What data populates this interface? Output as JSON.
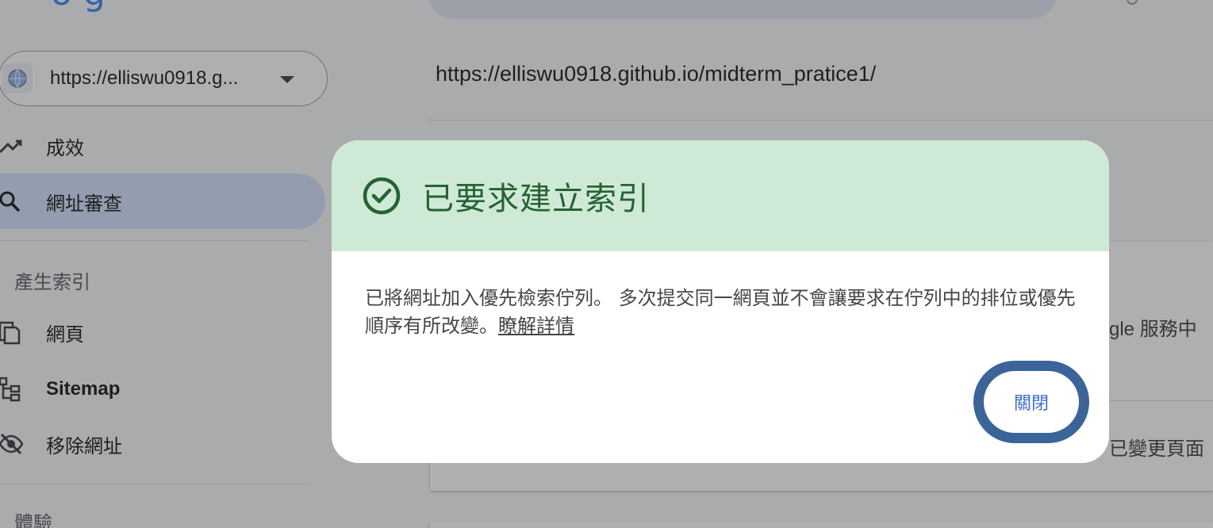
{
  "sidebar": {
    "property": "https://elliswu0918.g...",
    "items": [
      {
        "label": "成效",
        "icon": "trending-up-icon"
      },
      {
        "label": "網址審查",
        "icon": "search-icon",
        "active": true
      },
      {
        "label": "網頁",
        "icon": "pages-icon"
      },
      {
        "label": "Sitemap",
        "icon": "sitemap-icon"
      },
      {
        "label": "移除網址",
        "icon": "visibility-off-icon"
      }
    ],
    "sections": {
      "indexing": "產生索引",
      "experience": "體驗"
    }
  },
  "main": {
    "inspected_url": "https://elliswu0918.github.io/midterm_pratice1/",
    "card_text_1": "gle 服務中",
    "card_text_2": "已變更頁面"
  },
  "dialog": {
    "title": "已要求建立索引",
    "body": "已將網址加入優先檢索佇列。 多次提交同一網頁並不會讓要求在佇列中的排位或優先順序有所改變。",
    "learn_more": "瞭解詳情",
    "close_label": "關閉",
    "header_color": "#ceead6",
    "title_color": "#276233",
    "button_border_color": "#3b6499"
  }
}
